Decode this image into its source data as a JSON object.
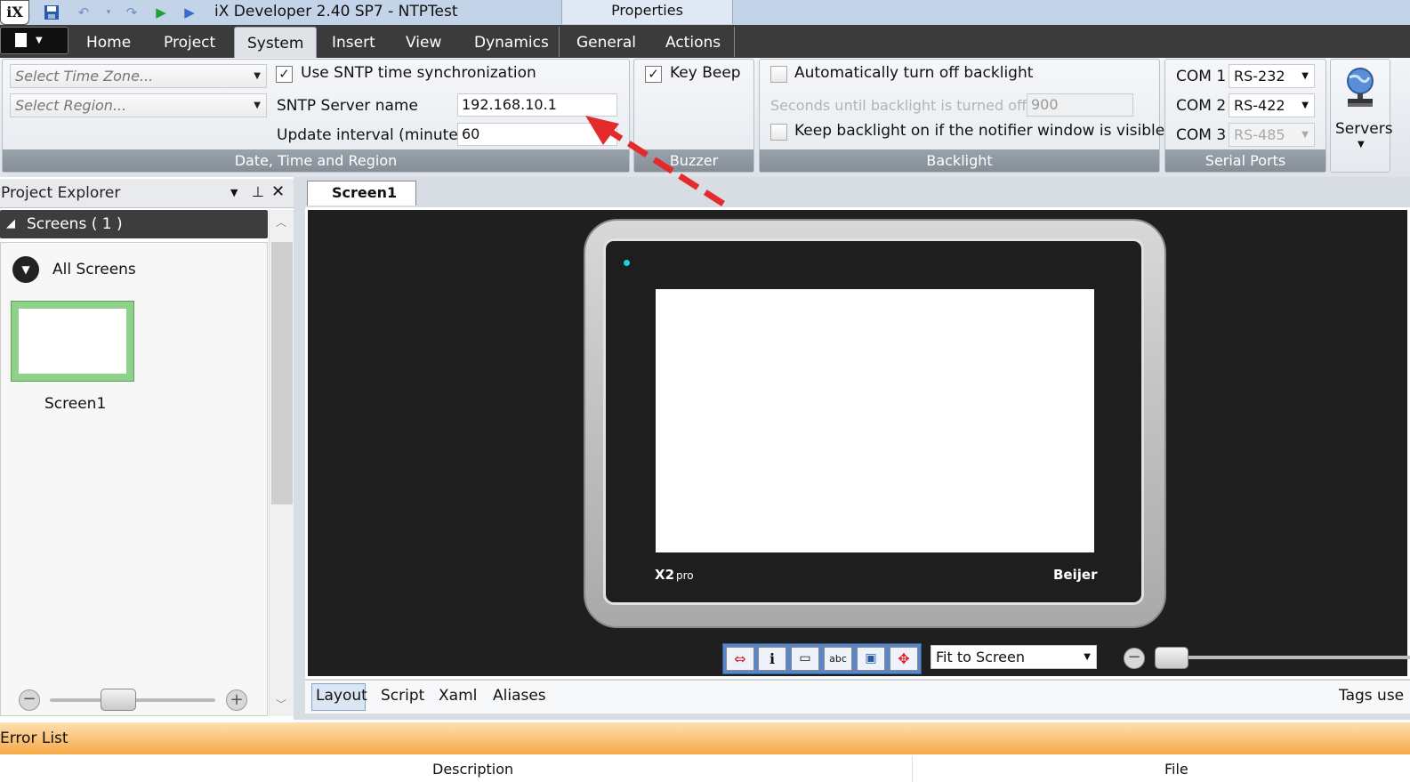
{
  "window": {
    "title": "iX Developer 2.40 SP7 - NTPTest",
    "context_tab_group": "Properties",
    "app_logo": "iX"
  },
  "quick_access": [
    "save-icon",
    "undo-icon",
    "undo-dropdown-icon",
    "redo-icon",
    "run-icon",
    "run-remote-icon"
  ],
  "menu_tabs": {
    "home": "Home",
    "project": "Project",
    "system": "System",
    "insert": "Insert",
    "view": "View",
    "dynamics": "Dynamics",
    "general": "General",
    "actions": "Actions"
  },
  "ribbon": {
    "date_time": {
      "time_zone_placeholder": "Select Time Zone...",
      "region_placeholder": "Select Region...",
      "use_sntp_label": "Use SNTP time synchronization",
      "use_sntp_checked": true,
      "server_name_label": "SNTP Server name",
      "server_name_value": "192.168.10.1",
      "update_interval_label": "Update interval (minutes)",
      "update_interval_value": "60",
      "group_label": "Date, Time and Region"
    },
    "buzzer": {
      "key_beep_label": "Key Beep",
      "key_beep_checked": true,
      "group_label": "Buzzer"
    },
    "backlight": {
      "auto_off_label": "Automatically turn off backlight",
      "seconds_label": "Seconds until backlight is turned off",
      "seconds_value": "900",
      "keep_on_label": "Keep backlight on if the notifier window is visible.",
      "group_label": "Backlight"
    },
    "serial_ports": {
      "com1_label": "COM 1",
      "com1_value": "RS-232",
      "com2_label": "COM 2",
      "com2_value": "RS-422",
      "com3_label": "COM 3",
      "com3_value": "RS-485",
      "group_label": "Serial Ports"
    },
    "servers": {
      "label": "Servers"
    }
  },
  "project_explorer": {
    "title": "Project Explorer",
    "screens_header": "Screens ( 1 )",
    "all_screens": "All Screens",
    "screen_item": "Screen1"
  },
  "editor": {
    "doc_tab": "Screen1",
    "device_brand_model": "X2",
    "device_brand_suffix": "pro",
    "device_maker": "Beijer",
    "zoom_mode": "Fit to Screen",
    "bottom_tabs": {
      "layout": "Layout",
      "script": "Script",
      "xaml": "Xaml",
      "aliases": "Aliases"
    },
    "tags_used": "Tags use"
  },
  "error_list": {
    "title": "Error List",
    "col_description": "Description",
    "col_file": "File"
  },
  "colors": {
    "annotation_arrow": "#e32b2b",
    "error_list_header": "#f6a847",
    "device_frame": "#b9b9b9",
    "led": "#1ad0e0"
  }
}
